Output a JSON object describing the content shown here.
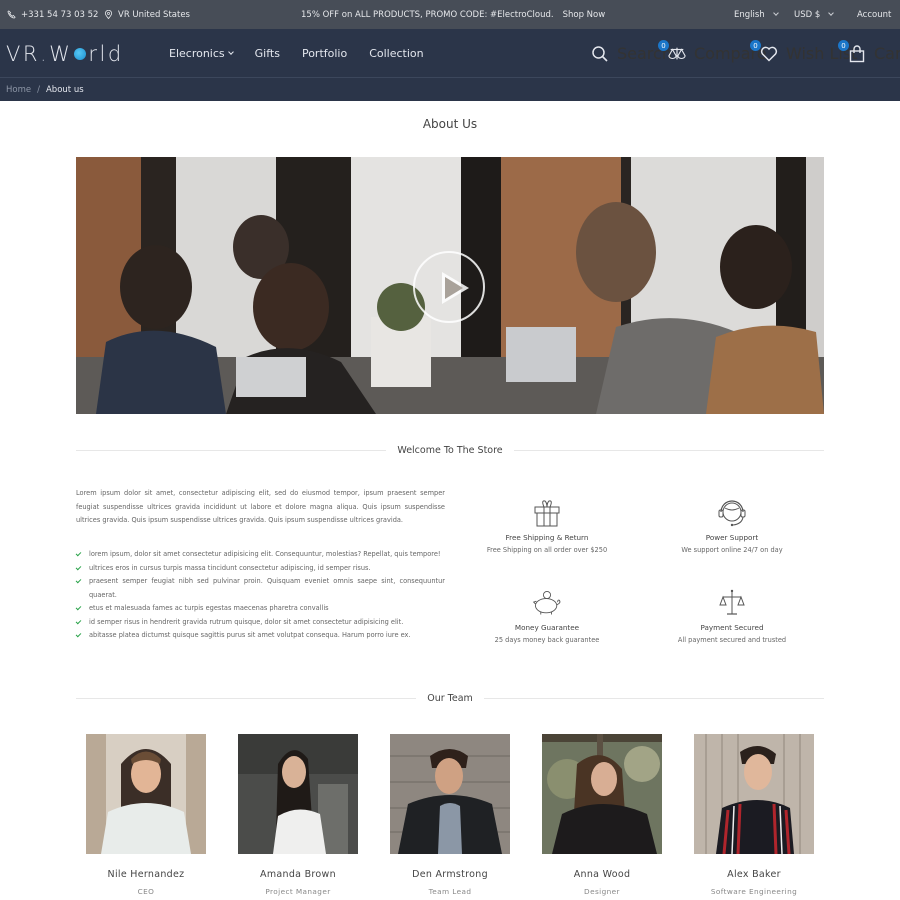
{
  "topbar": {
    "phone": "+331 54 73 03 52",
    "location": "VR United States",
    "promo": "15% OFF on ALL PRODUCTS, PROMO CODE: #ElectroCloud.",
    "promo_link": "Shop Now",
    "language": "English",
    "currency": "USD $",
    "account": "Account"
  },
  "header": {
    "logo": {
      "part1": "VR",
      "dot": ".",
      "part2": "W",
      "part3": "rld"
    },
    "nav": [
      {
        "label": "Elecronics",
        "has_dropdown": true
      },
      {
        "label": "Gifts"
      },
      {
        "label": "Portfolio"
      },
      {
        "label": "Collection"
      }
    ],
    "tools": {
      "search": "Search",
      "compare": "Compare",
      "compare_count": "0",
      "wishlist": "Wish List",
      "wishlist_count": "0",
      "cart": "Cart",
      "cart_count": "0"
    },
    "accent_color": "#1b76c9"
  },
  "breadcrumb": {
    "home": "Home",
    "separator": "/",
    "current": "About us"
  },
  "page": {
    "title": "About Us",
    "video": {
      "icon": "play-icon"
    }
  },
  "welcome": {
    "title": "Welcome To The Store",
    "intro": "Lorem ipsum dolor sit amet, consectetur adipiscing elit, sed do eiusmod tempor, ipsum praesent semper feugiat suspendisse ultrices gravida incididunt ut labore et dolore magna aliqua. Quis ipsum suspendisse ultrices gravida. Quis ipsum suspendisse ultrices gravida. Quis ipsum suspendisse ultrices gravida.",
    "checklist": [
      "lorem ipsum, dolor sit amet consectetur adipisicing elit. Consequuntur, molestias? Repellat, quis tempore!",
      "ultrices eros in cursus turpis massa tincidunt consectetur adipiscing, id semper risus.",
      "praesent semper feugiat nibh sed pulvinar proin. Quisquam eveniet omnis saepe sint, consequuntur quaerat.",
      "etus et malesuada fames ac turpis egestas maecenas pharetra convallis",
      "id semper risus in hendrerit gravida rutrum quisque, dolor sit amet consectetur adipisicing elit.",
      "abitasse platea dictumst quisque sagittis purus sit amet volutpat consequa. Harum porro iure ex."
    ],
    "features": [
      {
        "icon": "gift-icon",
        "title": "Free Shipping & Return",
        "desc": "Free Shipping on all order over $250"
      },
      {
        "icon": "headset-support-icon",
        "title": "Power Support",
        "desc": "We support online 24/7 on day"
      },
      {
        "icon": "piggy-bank-icon",
        "title": "Money Guarantee",
        "desc": "25 days money back guarantee"
      },
      {
        "icon": "scales-icon",
        "title": "Payment Secured",
        "desc": "All payment secured and trusted"
      }
    ]
  },
  "team": {
    "title": "Our Team",
    "members": [
      {
        "name": "Nile Hernandez",
        "role": "CEO"
      },
      {
        "name": "Amanda Brown",
        "role": "Project Manager"
      },
      {
        "name": "Den Armstrong",
        "role": "Team Lead"
      },
      {
        "name": "Anna Wood",
        "role": "Designer"
      },
      {
        "name": "Alex Baker",
        "role": "Software Engineering"
      }
    ]
  }
}
